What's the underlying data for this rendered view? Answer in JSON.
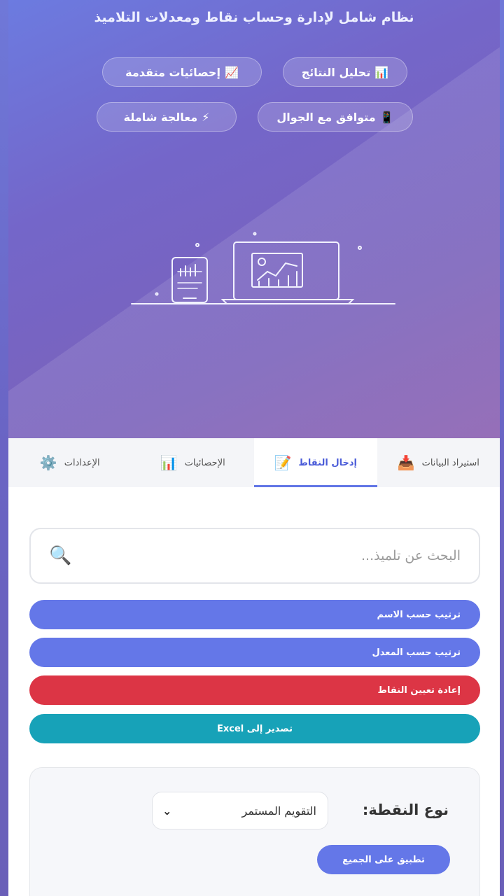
{
  "header": {
    "subtitle": "نظام شامل لإدارة وحساب نقاط ومعدلات التلاميذ",
    "features": [
      {
        "icon": "📊",
        "icon_name": "bar-chart-icon",
        "label": "تحليل النتائج"
      },
      {
        "icon": "📈",
        "icon_name": "trend-chart-icon",
        "label": "إحصائيات متقدمة"
      },
      {
        "icon": "📱",
        "icon_name": "mobile-icon",
        "label": "متوافق مع الجوال"
      },
      {
        "icon": "⚡",
        "icon_name": "lightning-icon",
        "label": "معالجة شاملة"
      }
    ]
  },
  "tabs": [
    {
      "icon": "📥",
      "icon_name": "import-icon",
      "label": "استيراد البيانات",
      "active": false
    },
    {
      "icon": "📝",
      "icon_name": "edit-note-icon",
      "label": "إدخال النقاط",
      "active": true
    },
    {
      "icon": "📊",
      "icon_name": "stats-chart-icon",
      "label": "الإحصائيات",
      "active": false
    },
    {
      "icon": "⚙️",
      "icon_name": "gear-icon",
      "label": "الإعدادات",
      "active": false
    }
  ],
  "search": {
    "placeholder": "البحث عن تلميذ...",
    "icon": "🔍",
    "icon_name": "search-icon"
  },
  "actions": {
    "sort_by_name": "ترتيب حسب الاسم",
    "sort_by_average": "ترتيب حسب المعدل",
    "reset_grades": "إعادة تعيين النقاط",
    "export_excel": "تصدير إلى Excel"
  },
  "grade_type": {
    "label": "نوع النقطة:",
    "selected": "التقويم المستمر",
    "apply_label": "تطبيق على الجميع"
  },
  "colors": {
    "primary": "#6477e8",
    "danger": "#dc3545",
    "info": "#17a2b8",
    "hero_start": "#6c7be0",
    "hero_end": "#8a5fb0"
  }
}
